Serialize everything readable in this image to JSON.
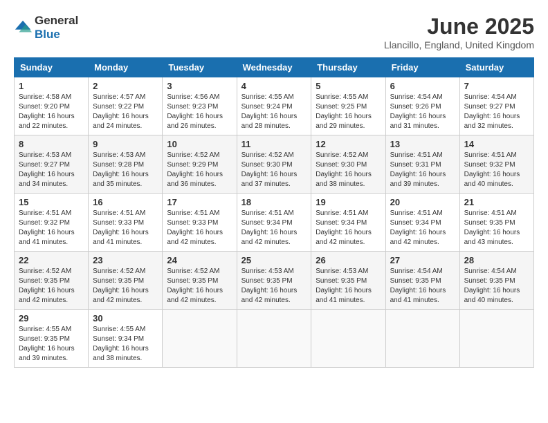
{
  "logo": {
    "general": "General",
    "blue": "Blue"
  },
  "title": "June 2025",
  "location": "Llancillo, England, United Kingdom",
  "days_of_week": [
    "Sunday",
    "Monday",
    "Tuesday",
    "Wednesday",
    "Thursday",
    "Friday",
    "Saturday"
  ],
  "weeks": [
    [
      {
        "day": "1",
        "sunrise": "4:58 AM",
        "sunset": "9:20 PM",
        "daylight": "16 hours and 22 minutes."
      },
      {
        "day": "2",
        "sunrise": "4:57 AM",
        "sunset": "9:22 PM",
        "daylight": "16 hours and 24 minutes."
      },
      {
        "day": "3",
        "sunrise": "4:56 AM",
        "sunset": "9:23 PM",
        "daylight": "16 hours and 26 minutes."
      },
      {
        "day": "4",
        "sunrise": "4:55 AM",
        "sunset": "9:24 PM",
        "daylight": "16 hours and 28 minutes."
      },
      {
        "day": "5",
        "sunrise": "4:55 AM",
        "sunset": "9:25 PM",
        "daylight": "16 hours and 29 minutes."
      },
      {
        "day": "6",
        "sunrise": "4:54 AM",
        "sunset": "9:26 PM",
        "daylight": "16 hours and 31 minutes."
      },
      {
        "day": "7",
        "sunrise": "4:54 AM",
        "sunset": "9:27 PM",
        "daylight": "16 hours and 32 minutes."
      }
    ],
    [
      {
        "day": "8",
        "sunrise": "4:53 AM",
        "sunset": "9:27 PM",
        "daylight": "16 hours and 34 minutes."
      },
      {
        "day": "9",
        "sunrise": "4:53 AM",
        "sunset": "9:28 PM",
        "daylight": "16 hours and 35 minutes."
      },
      {
        "day": "10",
        "sunrise": "4:52 AM",
        "sunset": "9:29 PM",
        "daylight": "16 hours and 36 minutes."
      },
      {
        "day": "11",
        "sunrise": "4:52 AM",
        "sunset": "9:30 PM",
        "daylight": "16 hours and 37 minutes."
      },
      {
        "day": "12",
        "sunrise": "4:52 AM",
        "sunset": "9:30 PM",
        "daylight": "16 hours and 38 minutes."
      },
      {
        "day": "13",
        "sunrise": "4:51 AM",
        "sunset": "9:31 PM",
        "daylight": "16 hours and 39 minutes."
      },
      {
        "day": "14",
        "sunrise": "4:51 AM",
        "sunset": "9:32 PM",
        "daylight": "16 hours and 40 minutes."
      }
    ],
    [
      {
        "day": "15",
        "sunrise": "4:51 AM",
        "sunset": "9:32 PM",
        "daylight": "16 hours and 41 minutes."
      },
      {
        "day": "16",
        "sunrise": "4:51 AM",
        "sunset": "9:33 PM",
        "daylight": "16 hours and 41 minutes."
      },
      {
        "day": "17",
        "sunrise": "4:51 AM",
        "sunset": "9:33 PM",
        "daylight": "16 hours and 42 minutes."
      },
      {
        "day": "18",
        "sunrise": "4:51 AM",
        "sunset": "9:34 PM",
        "daylight": "16 hours and 42 minutes."
      },
      {
        "day": "19",
        "sunrise": "4:51 AM",
        "sunset": "9:34 PM",
        "daylight": "16 hours and 42 minutes."
      },
      {
        "day": "20",
        "sunrise": "4:51 AM",
        "sunset": "9:34 PM",
        "daylight": "16 hours and 42 minutes."
      },
      {
        "day": "21",
        "sunrise": "4:51 AM",
        "sunset": "9:35 PM",
        "daylight": "16 hours and 43 minutes."
      }
    ],
    [
      {
        "day": "22",
        "sunrise": "4:52 AM",
        "sunset": "9:35 PM",
        "daylight": "16 hours and 42 minutes."
      },
      {
        "day": "23",
        "sunrise": "4:52 AM",
        "sunset": "9:35 PM",
        "daylight": "16 hours and 42 minutes."
      },
      {
        "day": "24",
        "sunrise": "4:52 AM",
        "sunset": "9:35 PM",
        "daylight": "16 hours and 42 minutes."
      },
      {
        "day": "25",
        "sunrise": "4:53 AM",
        "sunset": "9:35 PM",
        "daylight": "16 hours and 42 minutes."
      },
      {
        "day": "26",
        "sunrise": "4:53 AM",
        "sunset": "9:35 PM",
        "daylight": "16 hours and 41 minutes."
      },
      {
        "day": "27",
        "sunrise": "4:54 AM",
        "sunset": "9:35 PM",
        "daylight": "16 hours and 41 minutes."
      },
      {
        "day": "28",
        "sunrise": "4:54 AM",
        "sunset": "9:35 PM",
        "daylight": "16 hours and 40 minutes."
      }
    ],
    [
      {
        "day": "29",
        "sunrise": "4:55 AM",
        "sunset": "9:35 PM",
        "daylight": "16 hours and 39 minutes."
      },
      {
        "day": "30",
        "sunrise": "4:55 AM",
        "sunset": "9:34 PM",
        "daylight": "16 hours and 38 minutes."
      },
      null,
      null,
      null,
      null,
      null
    ]
  ],
  "labels": {
    "sunrise": "Sunrise:",
    "sunset": "Sunset:",
    "daylight": "Daylight:"
  }
}
